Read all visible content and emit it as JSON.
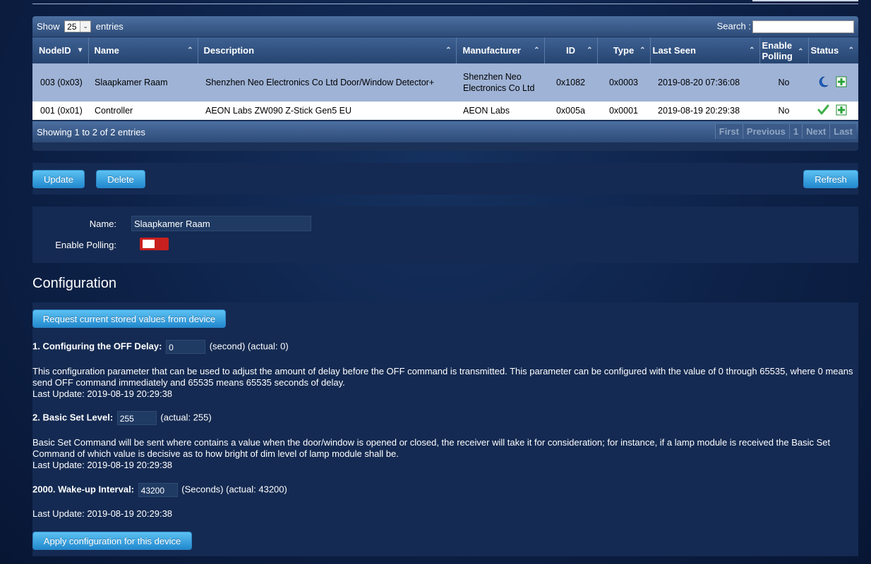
{
  "table": {
    "length_label_pre": "Show",
    "length_value": "25",
    "length_label_post": "entries",
    "search_label": "Search :",
    "columns": [
      "NodeID",
      "Name",
      "Description",
      "Manufacturer",
      "ID",
      "Type",
      "Last Seen",
      "Enable Polling",
      "Status"
    ],
    "rows": [
      {
        "nodeid": "003 (0x03)",
        "name": "Slaapkamer Raam",
        "description": "Shenzhen Neo Electronics Co Ltd Door/Window Detector+",
        "manufacturer": "Shenzhen Neo Electronics Co Ltd",
        "id": "0x1082",
        "type": "0x0003",
        "last_seen": "2019-08-20 07:36:08",
        "polling": "No",
        "status_icon": "moon-icon"
      },
      {
        "nodeid": "001 (0x01)",
        "name": "Controller",
        "description": "AEON Labs ZW090 Z-Stick Gen5 EU",
        "manufacturer": "AEON Labs",
        "id": "0x005a",
        "type": "0x0001",
        "last_seen": "2019-08-19 20:29:38",
        "polling": "No",
        "status_icon": "check-icon"
      }
    ],
    "info": "Showing 1 to 2 of 2 entries",
    "pager": [
      "First",
      "Previous",
      "1",
      "Next",
      "Last"
    ]
  },
  "buttons": {
    "update": "Update",
    "delete": "Delete",
    "refresh": "Refresh"
  },
  "node": {
    "name_label": "Name:",
    "name_value": "Slaapkamer Raam",
    "polling_label": "Enable Polling:",
    "polling_enabled": false
  },
  "config": {
    "title": "Configuration",
    "request_button": "Request current stored values from device",
    "params": [
      {
        "label": "1. Configuring the OFF Delay:",
        "value": "0",
        "suffix": "(second) (actual: 0)",
        "description": "This configuration parameter that can be used to adjust the amount of delay before the OFF command is transmitted. This parameter can be configured with the value of 0 through 65535, where 0 means send OFF command immediately and 65535 means 65535 seconds of delay.",
        "last_update": "Last Update: 2019-08-19 20:29:38"
      },
      {
        "label": "2. Basic Set Level:",
        "value": "255",
        "suffix": "(actual: 255)",
        "description": "Basic Set Command will be sent where contains a value when the door/window is opened or closed, the receiver will take it for consideration; for instance, if a lamp module is received the Basic Set Command of which value is decisive as to how bright of dim level of lamp module shall be.",
        "last_update": "Last Update: 2019-08-19 20:29:38"
      },
      {
        "label": "2000. Wake-up Interval:",
        "value": "43200",
        "suffix": "(Seconds) (actual: 43200)",
        "description": "",
        "last_update": "Last Update: 2019-08-19 20:29:38"
      }
    ],
    "apply_button": "Apply configuration for this device"
  },
  "colors": {
    "accent": "#2289cf",
    "selected_row": "#9fb3d6",
    "toggle_off": "#c8201e",
    "add_icon": "#2aa33a"
  }
}
